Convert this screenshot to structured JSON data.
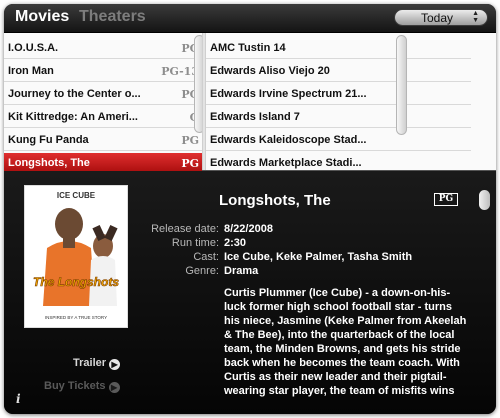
{
  "header": {
    "movies_tab": "Movies",
    "theaters_tab": "Theaters",
    "day_selected": "Today"
  },
  "movies": [
    {
      "title": "I.O.U.S.A.",
      "rating": "PG"
    },
    {
      "title": "Iron Man",
      "rating": "PG-13"
    },
    {
      "title": "Journey to the Center o...",
      "rating": "PG"
    },
    {
      "title": "Kit Kittredge: An Ameri...",
      "rating": "G"
    },
    {
      "title": "Kung Fu Panda",
      "rating": "PG"
    },
    {
      "title": "Longshots, The",
      "rating": "PG"
    }
  ],
  "theaters": [
    {
      "name": "AMC Tustin 14"
    },
    {
      "name": "Edwards Aliso Viejo 20"
    },
    {
      "name": "Edwards Irvine Spectrum 21..."
    },
    {
      "name": "Edwards Island 7"
    },
    {
      "name": "Edwards Kaleidoscope Stad..."
    },
    {
      "name": "Edwards Marketplace Stadi..."
    }
  ],
  "selected_movie_index": 5,
  "detail": {
    "title": "Longshots, The",
    "rating": "PG",
    "release_label": "Release date:",
    "release": "8/22/2008",
    "runtime_label": "Run time:",
    "runtime": "2:30",
    "cast_label": "Cast:",
    "cast": "Ice Cube, Keke Palmer, Tasha Smith",
    "genre_label": "Genre:",
    "genre": "Drama",
    "synopsis": "Curtis Plummer (Ice Cube) - a down-on-his-luck former high school football star - turns his niece, Jasmine (Keke Palmer from Akeelah & The Bee), into the quarterback of the local team, the Minden Browns, and gets his stride back when he becomes the team coach. With Curtis as their new leader and their pigtail-wearing star player, the team of misfits wins",
    "trailer_label": "Trailer",
    "buy_label": "Buy Tickets",
    "poster": {
      "top_text": "ICE CUBE",
      "logo_text": "The Longshots",
      "tagline": "INSPIRED BY A TRUE STORY"
    }
  },
  "colors": {
    "selection": "#c41818",
    "panel_bg": "#0c0c0c",
    "list_bg": "#fafafa"
  }
}
